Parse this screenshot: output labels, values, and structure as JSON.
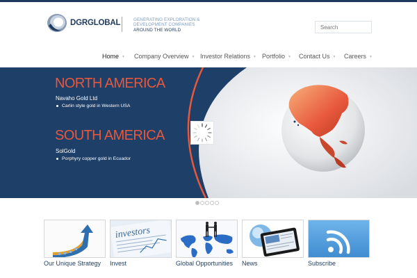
{
  "brand": {
    "logo_text": "DGRGLOBAL",
    "tagline": [
      "GENERATING EXPLORATION &",
      "DEVELOPMENT COMPANIES",
      "AROUND THE WORLD"
    ]
  },
  "search": {
    "placeholder": "Search"
  },
  "nav": {
    "items": [
      {
        "label": "Home"
      },
      {
        "label": "Company Overview"
      },
      {
        "label": "Investor Relations"
      },
      {
        "label": "Portfolio"
      },
      {
        "label": "Contact Us"
      },
      {
        "label": "Careers"
      }
    ],
    "active": "Home"
  },
  "slider": {
    "regions": [
      {
        "title": "NORTH AMERICA",
        "company": "Navaho Gold Ltd",
        "bullet": "Carlin style gold in Western USA"
      },
      {
        "title": "SOUTH AMERICA",
        "company": "SolGold",
        "bullet": "Porphyry copper gold in Ecuador"
      }
    ],
    "slide_count": 5,
    "active_slide": 1
  },
  "tiles": [
    {
      "label": "Our Unique Strategy",
      "icon": "growth-arrow-icon"
    },
    {
      "label": "Invest",
      "icon": "investors-newspaper-icon"
    },
    {
      "label": "Global Opportunities",
      "icon": "world-map-icon"
    },
    {
      "label": "News",
      "icon": "tablet-globe-icon"
    },
    {
      "label": "Subscribe",
      "icon": "rss-icon"
    }
  ],
  "colors": {
    "brand_navy": "#1e3a5f",
    "accent_orange": "#e8583c",
    "hero_bg": "#1e3f68",
    "rss_blue": "#4a9bdb"
  }
}
